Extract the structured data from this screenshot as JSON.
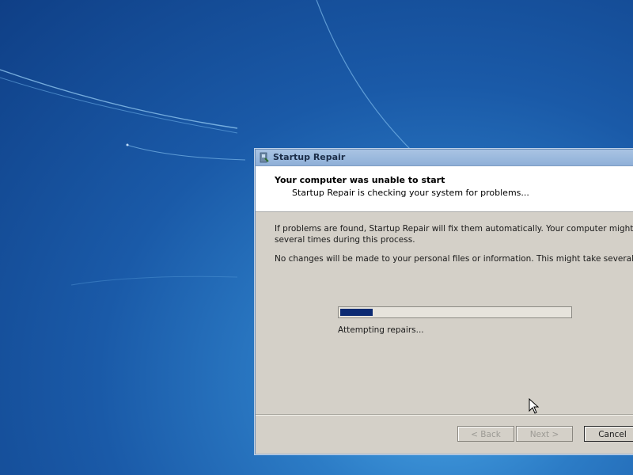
{
  "window": {
    "title": "Startup Repair",
    "icon": "startup-repair-icon"
  },
  "header": {
    "title": "Your computer was unable to start",
    "subtitle": "Startup Repair is checking your system for problems..."
  },
  "body": {
    "paragraph1_line1": "If problems are found, Startup Repair will fix them automatically. Your computer might restart",
    "paragraph1_line2": "several times during this process.",
    "paragraph2": "No changes will be made to your personal files or information. This might take several minutes."
  },
  "progress": {
    "fraction": 0.14,
    "fill_color": "#0c2a72",
    "status": "Attempting repairs..."
  },
  "buttons": {
    "back": "< Back",
    "next": "Next >",
    "cancel": "Cancel"
  },
  "colors": {
    "desktop_dark": "#0f3f86",
    "desktop_light": "#4aa6e6",
    "dialog_face": "#d4d0c8",
    "titlebar": "#a9c3e3"
  }
}
